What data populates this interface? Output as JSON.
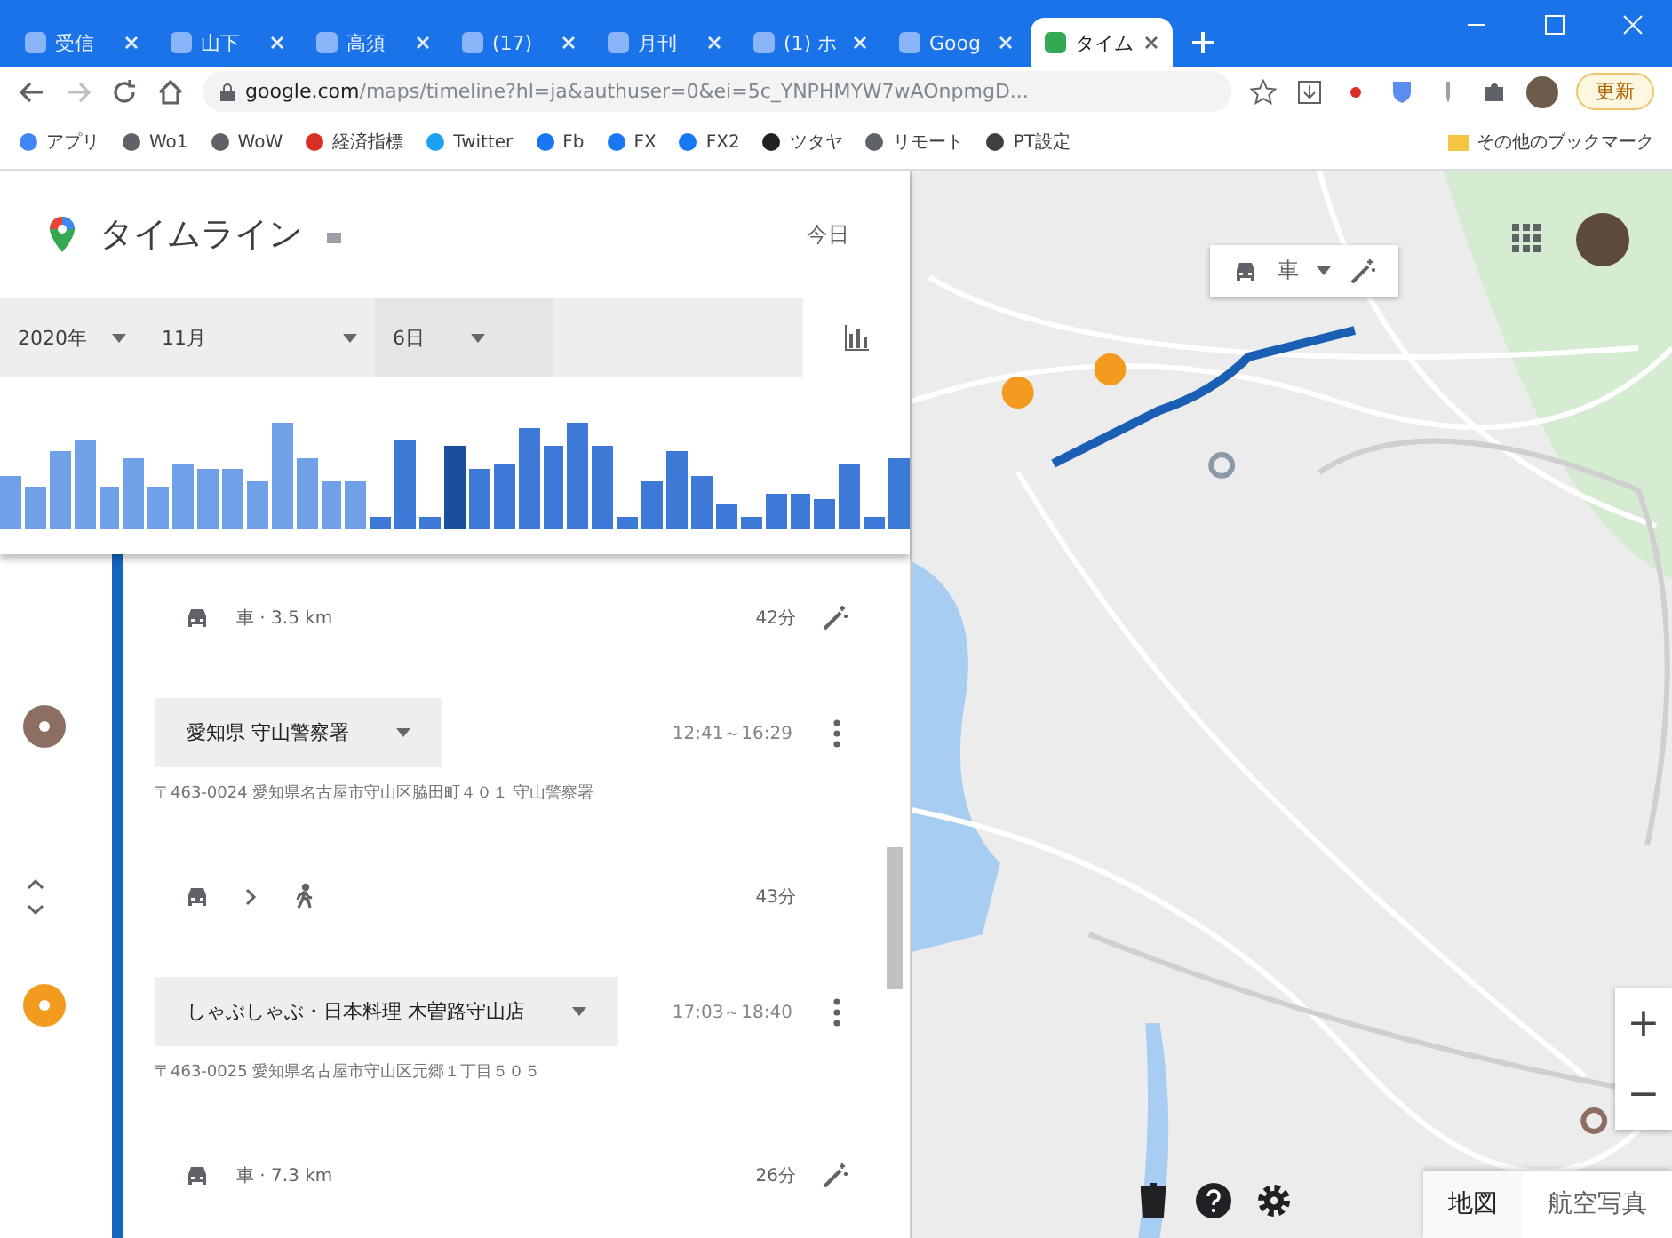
{
  "browser": {
    "tabs": [
      {
        "title": "受信",
        "selected": false
      },
      {
        "title": "山下",
        "selected": false
      },
      {
        "title": "高須",
        "selected": false
      },
      {
        "title": "(17)",
        "selected": false
      },
      {
        "title": "月刊",
        "selected": false
      },
      {
        "title": "(1) ホ",
        "selected": false
      },
      {
        "title": "Goog",
        "selected": false
      },
      {
        "title": "タイム",
        "selected": true
      }
    ],
    "url_host": "google.com",
    "url_path": "/maps/timeline?hl=ja&authuser=0&ei=5c_YNPHMYW7wAOnpmgD...",
    "update_button": "更新",
    "bookmarks": [
      {
        "label": "アプリ",
        "color": "#4285f4"
      },
      {
        "label": "Wo1",
        "color": "#5f6368"
      },
      {
        "label": "WoW",
        "color": "#5f6368"
      },
      {
        "label": "経済指標",
        "color": "#d93025"
      },
      {
        "label": "Twitter",
        "color": "#1da1f2"
      },
      {
        "label": "Fb",
        "color": "#1877f2"
      },
      {
        "label": "FX",
        "color": "#1877f2"
      },
      {
        "label": "FX2",
        "color": "#1877f2"
      },
      {
        "label": "ツタヤ",
        "color": "#202124"
      },
      {
        "label": "リモート",
        "color": "#5f6368"
      },
      {
        "label": "PT設定",
        "color": "#3c4043"
      }
    ],
    "other_bookmarks": "その他のブックマーク"
  },
  "timeline": {
    "title": "タイムライン",
    "today": "今日",
    "year": "2020年",
    "month": "11月",
    "day": "6日",
    "entries": [
      {
        "kind": "move",
        "modes": [
          {
            "kind": "car"
          }
        ],
        "label": "車 · 3.5 km",
        "duration": "42分"
      },
      {
        "kind": "place",
        "color": "#8d6e63",
        "name": "愛知県 守山警察署",
        "time": "12:41～16:29",
        "address": "〒463-0024 愛知県名古屋市守山区脇田町４０１ 守山警察署"
      },
      {
        "kind": "move",
        "modes": [
          {
            "kind": "car"
          },
          {
            "kind": "walk"
          }
        ],
        "duration": "43分"
      },
      {
        "kind": "place",
        "color": "#f29b1f",
        "name": "しゃぶしゃぶ・日本料理 木曽路守山店",
        "time": "17:03～18:40",
        "address": "〒463-0025 愛知県名古屋市守山区元郷１丁目５０５"
      },
      {
        "kind": "move",
        "modes": [
          {
            "kind": "car"
          }
        ],
        "label": "車 · 7.3 km",
        "duration": "26分"
      }
    ]
  },
  "map": {
    "route_mode": "車",
    "zoom_in": "+",
    "zoom_out": "−",
    "view_buttons": [
      {
        "label": "地図",
        "selected": true
      },
      {
        "label": "航空写真",
        "selected": false
      }
    ]
  }
}
